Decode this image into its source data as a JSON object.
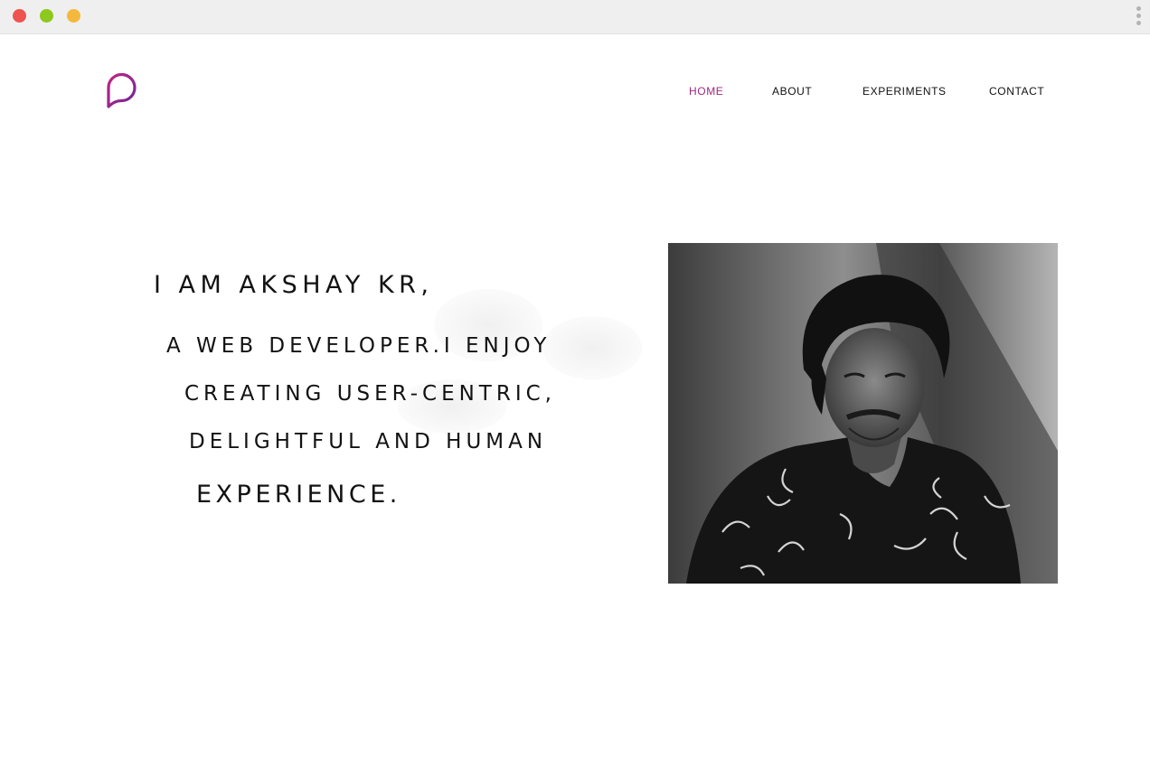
{
  "nav": {
    "items": [
      {
        "label": "HOME",
        "active": true
      },
      {
        "label": "ABOUT",
        "active": false
      },
      {
        "label": "EXPERIMENTS",
        "active": false
      },
      {
        "label": "CONTACT",
        "active": false
      }
    ]
  },
  "hero": {
    "lines": [
      "I AM AKSHAY KR,",
      "A WEB DEVELOPER.I ENJOY",
      "CREATING USER-CENTRIC,",
      "DELIGHTFUL AND HUMAN",
      "EXPERIENCE."
    ]
  },
  "colors": {
    "accent": "#a0267f",
    "logo_start": "#c2237f",
    "logo_end": "#6c2a9b",
    "text": "#121212",
    "titlebar": "#efefef"
  },
  "icons": {
    "logo": "speech-bubble-p-logo",
    "window_controls": [
      "close-dot",
      "maximize-dot",
      "minimize-dot"
    ],
    "menu": "kebab-menu-icon"
  },
  "images": {
    "portrait": "black-and-white portrait photo"
  }
}
